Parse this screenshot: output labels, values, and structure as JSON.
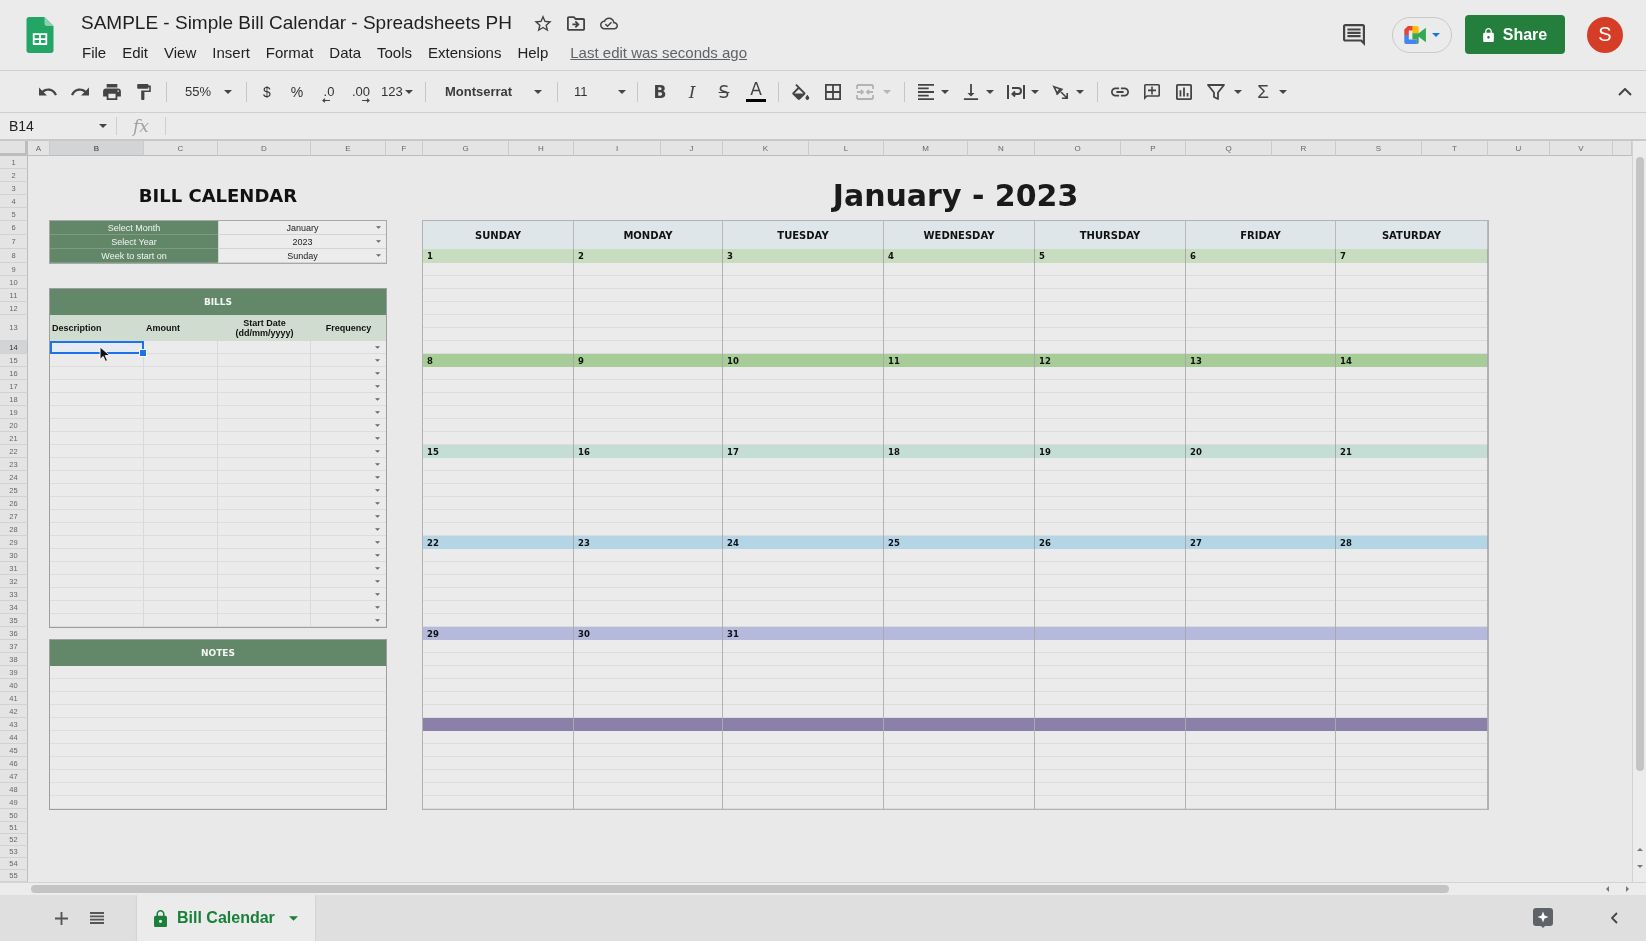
{
  "document": {
    "title": "SAMPLE - Simple Bill Calendar - Spreadsheets PH",
    "last_edit": "Last edit was seconds ago"
  },
  "menu": [
    "File",
    "Edit",
    "View",
    "Insert",
    "Format",
    "Data",
    "Tools",
    "Extensions",
    "Help"
  ],
  "share_button": "Share",
  "avatar": "S",
  "toolbar": {
    "zoom": "55%",
    "currency": "$",
    "percent": "%",
    "decrease_decimal": ".0",
    "increase_decimal": ".00",
    "number_format": "123",
    "font": "Montserrat",
    "font_size": "11",
    "bold": "B",
    "italic": "I",
    "strikethrough": "S",
    "text_color": "A",
    "functions": "Σ",
    "merge_disabled": true
  },
  "formula_bar": {
    "cell_ref": "B14",
    "fx": "fx"
  },
  "columns": [
    {
      "label": "A",
      "selected": false
    },
    {
      "label": "B",
      "selected": true
    },
    {
      "label": "C",
      "selected": false
    },
    {
      "label": "D",
      "selected": false
    },
    {
      "label": "E",
      "selected": false
    },
    {
      "label": "F",
      "selected": false
    },
    {
      "label": "G",
      "selected": false
    },
    {
      "label": "H",
      "selected": false
    },
    {
      "label": "I",
      "selected": false
    },
    {
      "label": "J",
      "selected": false
    },
    {
      "label": "K",
      "selected": false
    },
    {
      "label": "L",
      "selected": false
    },
    {
      "label": "M",
      "selected": false
    },
    {
      "label": "N",
      "selected": false
    },
    {
      "label": "O",
      "selected": false
    },
    {
      "label": "P",
      "selected": false
    },
    {
      "label": "Q",
      "selected": false
    },
    {
      "label": "R",
      "selected": false
    },
    {
      "label": "S",
      "selected": false
    },
    {
      "label": "T",
      "selected": false
    },
    {
      "label": "U",
      "selected": false
    },
    {
      "label": "V",
      "selected": false
    }
  ],
  "rows": [
    {
      "label": "1",
      "selected": false
    },
    {
      "label": "2",
      "selected": false
    },
    {
      "label": "3",
      "selected": false
    },
    {
      "label": "4",
      "selected": false
    },
    {
      "label": "5",
      "selected": false
    },
    {
      "label": "6",
      "selected": false
    },
    {
      "label": "7",
      "selected": false
    },
    {
      "label": "8",
      "selected": false
    },
    {
      "label": "9",
      "selected": false
    },
    {
      "label": "10",
      "selected": false
    },
    {
      "label": "11",
      "selected": false
    },
    {
      "label": "12",
      "selected": false
    },
    {
      "label": "13",
      "selected": false
    },
    {
      "label": "14",
      "selected": true
    },
    {
      "label": "15",
      "selected": false
    },
    {
      "label": "16",
      "selected": false
    },
    {
      "label": "17",
      "selected": false
    },
    {
      "label": "18",
      "selected": false
    },
    {
      "label": "19",
      "selected": false
    },
    {
      "label": "20",
      "selected": false
    },
    {
      "label": "21",
      "selected": false
    },
    {
      "label": "22",
      "selected": false
    },
    {
      "label": "23",
      "selected": false
    },
    {
      "label": "24",
      "selected": false
    },
    {
      "label": "25",
      "selected": false
    },
    {
      "label": "26",
      "selected": false
    },
    {
      "label": "27",
      "selected": false
    },
    {
      "label": "28",
      "selected": false
    },
    {
      "label": "29",
      "selected": false
    },
    {
      "label": "30",
      "selected": false
    },
    {
      "label": "31",
      "selected": false
    },
    {
      "label": "32",
      "selected": false
    },
    {
      "label": "33",
      "selected": false
    },
    {
      "label": "34",
      "selected": false
    },
    {
      "label": "35",
      "selected": false
    },
    {
      "label": "36",
      "selected": false
    },
    {
      "label": "37",
      "selected": false
    },
    {
      "label": "38",
      "selected": false
    },
    {
      "label": "39",
      "selected": false
    },
    {
      "label": "40",
      "selected": false
    },
    {
      "label": "41",
      "selected": false
    },
    {
      "label": "42",
      "selected": false
    },
    {
      "label": "43",
      "selected": false
    },
    {
      "label": "44",
      "selected": false
    },
    {
      "label": "45",
      "selected": false
    },
    {
      "label": "46",
      "selected": false
    },
    {
      "label": "47",
      "selected": false
    },
    {
      "label": "48",
      "selected": false
    },
    {
      "label": "49",
      "selected": false
    },
    {
      "label": "50",
      "selected": false
    },
    {
      "label": "51",
      "selected": false
    },
    {
      "label": "52",
      "selected": false
    },
    {
      "label": "53",
      "selected": false
    },
    {
      "label": "54",
      "selected": false
    },
    {
      "label": "55",
      "selected": false
    }
  ],
  "bill_calendar": {
    "title": "BILL CALENDAR",
    "settings": [
      {
        "label": "Select Month",
        "value": "January",
        "dropdown": true
      },
      {
        "label": "Select Year",
        "value": "2023",
        "dropdown": true
      },
      {
        "label": "Week to start on",
        "value": "Sunday",
        "dropdown": true
      }
    ],
    "bills": {
      "title": "BILLS",
      "columns": [
        "Description",
        "Amount",
        "Start Date (dd/mm/yyyy)",
        "Frequency"
      ],
      "rows": [
        {
          "selected": true,
          "dropdown": true
        },
        {
          "selected": false,
          "dropdown": true
        },
        {
          "selected": false,
          "dropdown": true
        },
        {
          "selected": false,
          "dropdown": true
        },
        {
          "selected": false,
          "dropdown": true
        },
        {
          "selected": false,
          "dropdown": true
        },
        {
          "selected": false,
          "dropdown": true
        },
        {
          "selected": false,
          "dropdown": true
        },
        {
          "selected": false,
          "dropdown": true
        },
        {
          "selected": false,
          "dropdown": true
        },
        {
          "selected": false,
          "dropdown": true
        },
        {
          "selected": false,
          "dropdown": true
        },
        {
          "selected": false,
          "dropdown": true
        },
        {
          "selected": false,
          "dropdown": true
        },
        {
          "selected": false,
          "dropdown": true
        },
        {
          "selected": false,
          "dropdown": true
        },
        {
          "selected": false,
          "dropdown": true
        },
        {
          "selected": false,
          "dropdown": true
        },
        {
          "selected": false,
          "dropdown": true
        },
        {
          "selected": false,
          "dropdown": true
        },
        {
          "selected": false,
          "dropdown": true
        },
        {
          "selected": false,
          "dropdown": true
        }
      ]
    },
    "notes": {
      "title": "NOTES"
    }
  },
  "calendar": {
    "title": "January - 2023",
    "weekdays": [
      "SUNDAY",
      "MONDAY",
      "TUESDAY",
      "WEDNESDAY",
      "THURSDAY",
      "FRIDAY",
      "SATURDAY"
    ],
    "weeks": [
      {
        "color": "#c8dcc0",
        "days": [
          "1",
          "2",
          "3",
          "4",
          "5",
          "6",
          "7"
        ]
      },
      {
        "color": "#a8cc98",
        "days": [
          "8",
          "9",
          "10",
          "11",
          "12",
          "13",
          "14"
        ]
      },
      {
        "color": "#c5ded5",
        "days": [
          "15",
          "16",
          "17",
          "18",
          "19",
          "20",
          "21"
        ]
      },
      {
        "color": "#b3d5e5",
        "days": [
          "22",
          "23",
          "24",
          "25",
          "26",
          "27",
          "28"
        ]
      },
      {
        "color": "#b5b9dc",
        "days": [
          "29",
          "30",
          "31"
        ]
      },
      {
        "color": "#8a80aa"
      }
    ]
  },
  "sheet_tabs": [
    {
      "label": "Bill Calendar",
      "selected": true,
      "locked": true
    }
  ]
}
